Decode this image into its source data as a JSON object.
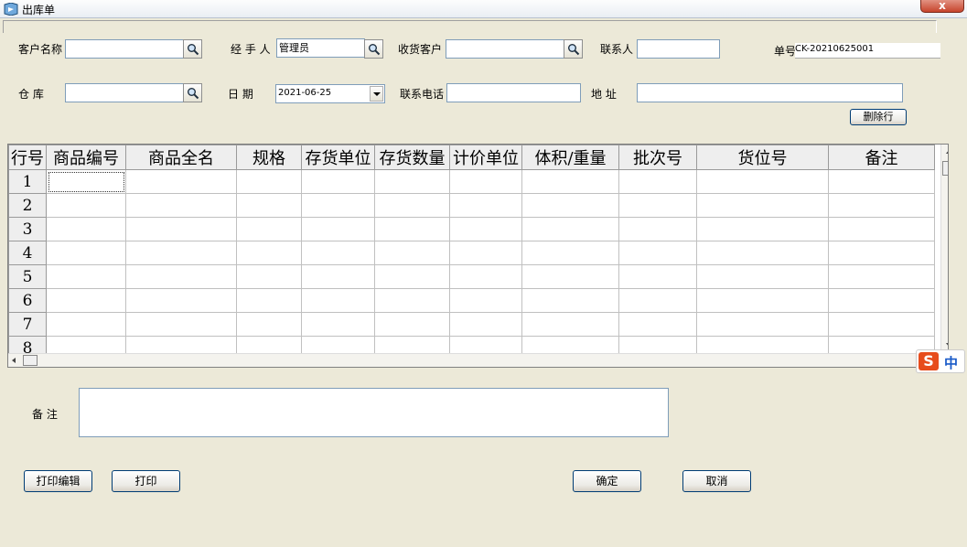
{
  "window": {
    "title": "出库单",
    "close_label": "x"
  },
  "header": {
    "customer_name_label": "客户名称",
    "handler_label": "经 手 人",
    "handler_value": "管理员",
    "receiver_label": "收货客户",
    "contact_label": "联系人",
    "order_no_label": "单号",
    "order_no_value": "CK-20210625001",
    "warehouse_label": "仓    库",
    "date_label": "日    期",
    "date_value": "2021-06-25",
    "phone_label": "联系电话",
    "address_label": "地    址",
    "delete_row_label": "删除行"
  },
  "grid": {
    "columns": [
      "行号",
      "商品编号",
      "商品全名",
      "规格",
      "存货单位",
      "存货数量",
      "计价单位",
      "体积/重量",
      "批次号",
      "货位号",
      "备注"
    ],
    "rows": [
      "1",
      "2",
      "3",
      "4",
      "5",
      "6",
      "7",
      "8"
    ]
  },
  "footer": {
    "remark_label": "备    注",
    "print_edit_label": "打印编辑",
    "print_label": "打印",
    "ok_label": "确定",
    "cancel_label": "取消"
  },
  "ime": {
    "logo": "S",
    "mode": "中"
  }
}
